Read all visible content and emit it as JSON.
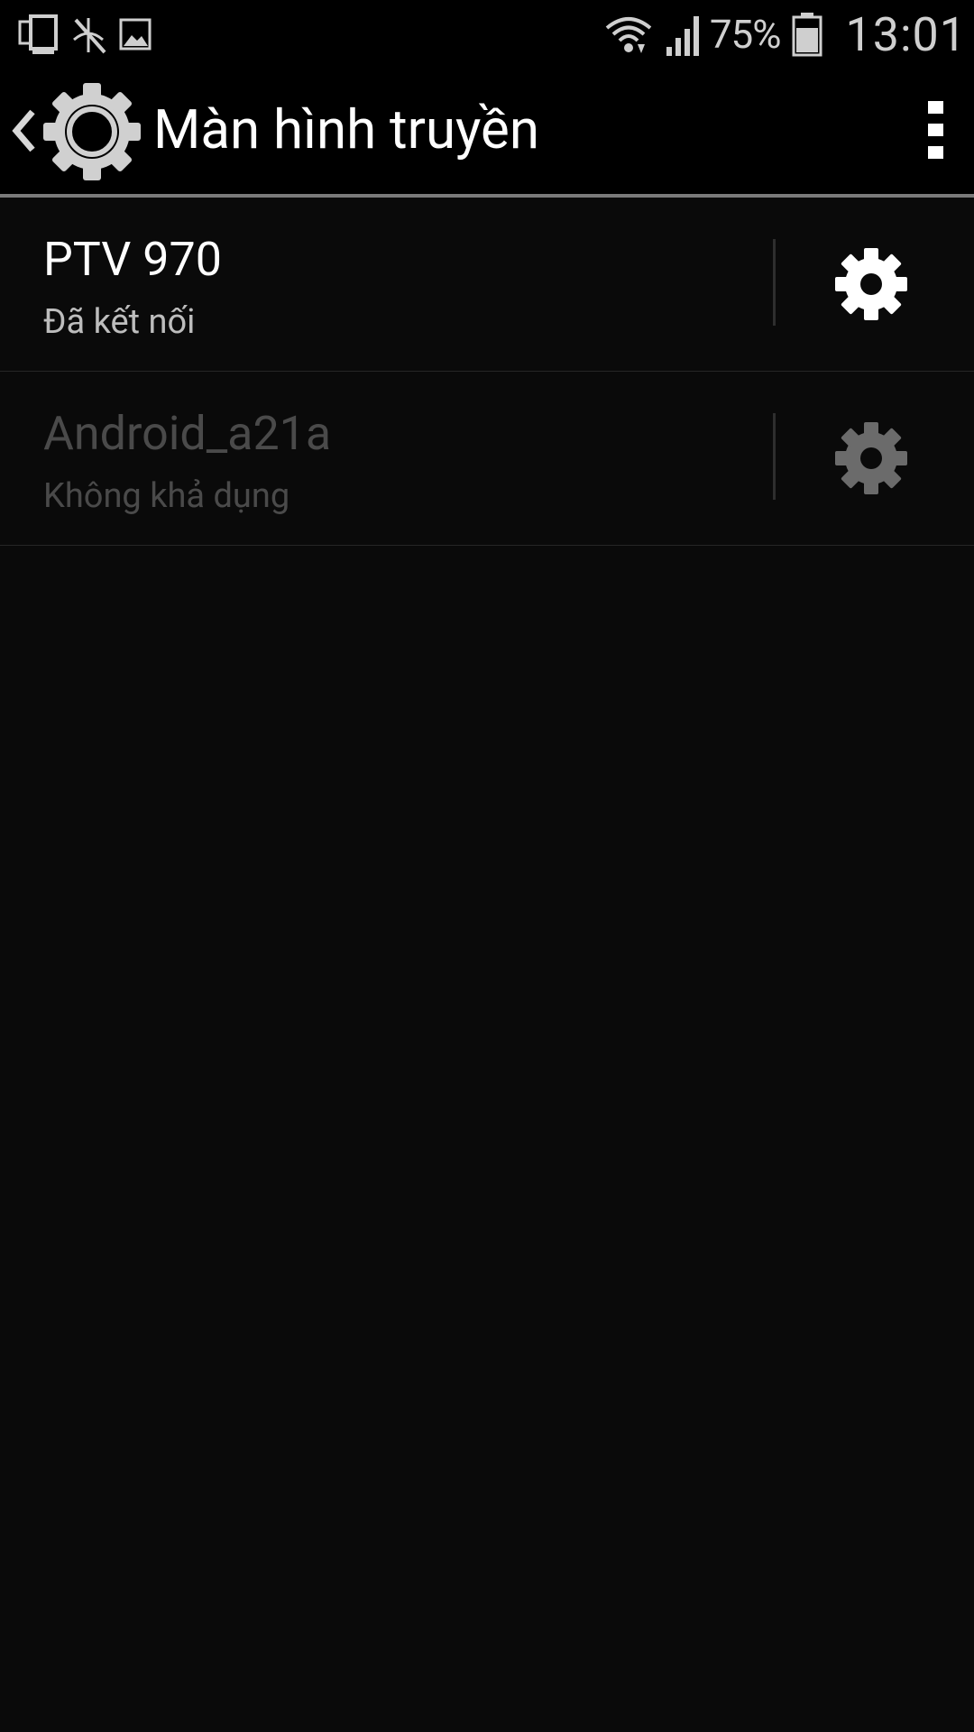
{
  "status_bar": {
    "left_icons": [
      "screen-mirroring-icon",
      "missed-call-icon",
      "gallery-icon"
    ],
    "right_icons": [
      "wifi-icon",
      "signal-icon",
      "battery-icon"
    ],
    "battery_percent": "75%",
    "time": "13:01"
  },
  "action_bar": {
    "back_icon": "chevron-left-icon",
    "app_icon": "settings-gear-icon",
    "title": "Màn hình truyền",
    "overflow_icon": "more-vert-icon"
  },
  "devices": [
    {
      "name": "PTV 970",
      "status": "Đã kết nối",
      "enabled": true,
      "settings_icon": "gear-icon"
    },
    {
      "name": "Android_a21a",
      "status": "Không khả dụng",
      "enabled": false,
      "settings_icon": "gear-icon"
    }
  ],
  "colors": {
    "background": "#0a0a0a",
    "bar_background": "#000000",
    "divider": "#7a7a7a",
    "text_primary": "#ffffff",
    "text_secondary": "#bdbdbd",
    "text_disabled": "#4a4a4a",
    "gear_enabled": "#ffffff",
    "gear_disabled": "#6b6b6b"
  }
}
